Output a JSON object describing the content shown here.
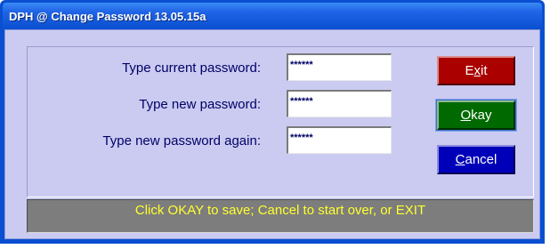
{
  "window": {
    "title": "DPH @ Change Password 13.05.15a"
  },
  "form": {
    "current_label": "Type current password:",
    "current_value": "******",
    "new_label": "Type new password:",
    "new_value": "******",
    "again_label": "Type new password again:",
    "again_value": "******"
  },
  "buttons": {
    "exit_pre": "E",
    "exit_accel": "x",
    "exit_post": "it",
    "okay_accel": "O",
    "okay_post": "kay",
    "cancel_accel": "C",
    "cancel_post": "ancel"
  },
  "status": {
    "message": "Click OKAY to save; Cancel to start over, or EXIT"
  },
  "colors": {
    "exit": "#aa0000",
    "okay": "#006a00",
    "cancel": "#0000b8",
    "status_text": "#ffff30"
  }
}
